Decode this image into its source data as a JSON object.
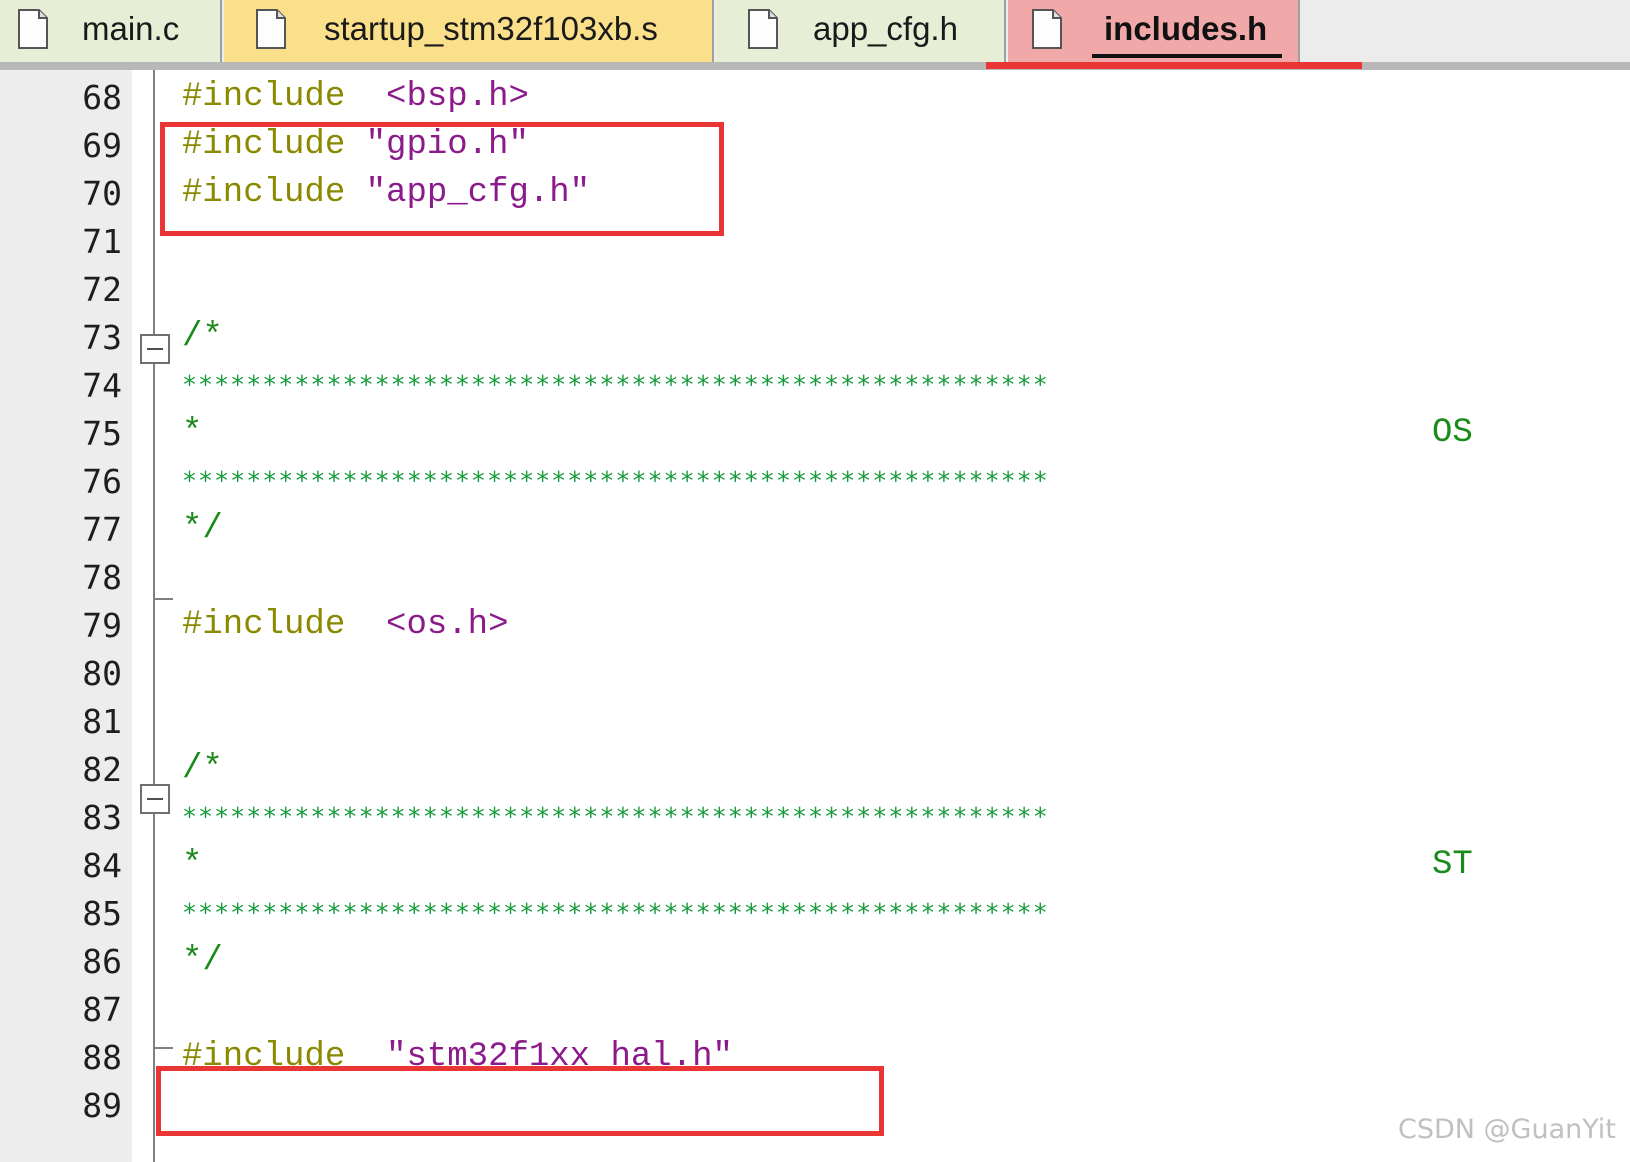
{
  "tabs": [
    {
      "label": "main.c",
      "icon": "file-icon",
      "color": "#e6eed6"
    },
    {
      "label": "startup_stm32f103xb.s",
      "icon": "file-icon",
      "color": "#fbe08c"
    },
    {
      "label": "app_cfg.h",
      "icon": "file-icon",
      "color": "#e6eed6"
    },
    {
      "label": "includes.h",
      "icon": "file-icon",
      "color": "#f0a8a8",
      "active": true
    }
  ],
  "lines": [
    {
      "n": "68",
      "kw": "#include",
      "str": "<bsp.h>"
    },
    {
      "n": "69",
      "kw": "#include",
      "str": "\"gpio.h\""
    },
    {
      "n": "70",
      "kw": "#include",
      "str": "\"app_cfg.h\""
    },
    {
      "n": "71"
    },
    {
      "n": "72"
    },
    {
      "n": "73",
      "comment": "/*"
    },
    {
      "n": "74",
      "stars": "******************************************************"
    },
    {
      "n": "75",
      "comment": "*",
      "word": "OS"
    },
    {
      "n": "76",
      "stars": "******************************************************"
    },
    {
      "n": "77",
      "comment": "*/"
    },
    {
      "n": "78"
    },
    {
      "n": "79",
      "kw": "#include",
      "str": "<os.h>"
    },
    {
      "n": "80"
    },
    {
      "n": "81"
    },
    {
      "n": "82",
      "comment": "/*"
    },
    {
      "n": "83",
      "stars": "******************************************************"
    },
    {
      "n": "84",
      "comment": "*",
      "word": "ST"
    },
    {
      "n": "85",
      "stars": "******************************************************"
    },
    {
      "n": "86",
      "comment": "*/"
    },
    {
      "n": "87"
    },
    {
      "n": "88",
      "kw": "#include",
      "str": "\"stm32f1xx_hal.h\""
    },
    {
      "n": "89"
    }
  ],
  "watermark": "CSDN @GuanYit",
  "colors": {
    "highlight": "#ea3535",
    "keyword": "#8a8a00",
    "string": "#8b1a8b",
    "comment": "#1a8a1a"
  }
}
